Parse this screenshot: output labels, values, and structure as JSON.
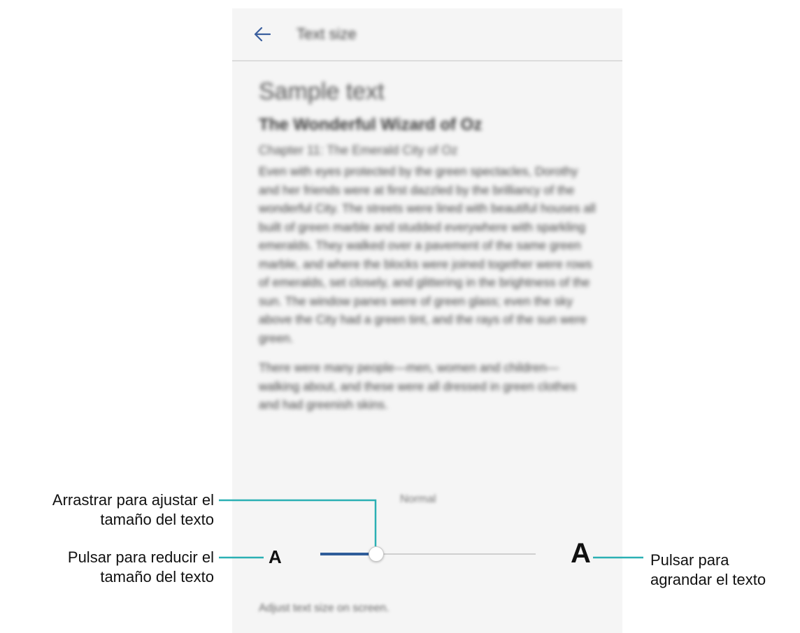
{
  "header": {
    "title": "Text size",
    "back_icon": "arrow-left-icon"
  },
  "preview": {
    "heading": "Sample text",
    "book_title": "The Wonderful Wizard of Oz",
    "chapter": "Chapter 11: The Emerald City of Oz",
    "paragraphs": [
      "Even with eyes protected by the green spectacles, Dorothy and her friends were at first dazzled by the brilliancy of the wonderful City. The streets were lined with beautiful houses all built of green marble and studded everywhere with sparkling emeralds. They walked over a pavement of the same green marble, and where the blocks were joined together were rows of emeralds, set closely, and glittering in the brightness of the sun. The window panes were of green glass; even the sky above the City had a green tint, and the rays of the sun were green.",
      "There were many people—men, women and children—walking about, and these were all dressed in green clothes and had greenish skins."
    ]
  },
  "slider": {
    "current_label": "Normal",
    "small_label": "A",
    "large_label": "A",
    "value_fraction": 0.26
  },
  "footer_hint": "Adjust text size on screen.",
  "callouts": {
    "drag_line1": "Arrastrar para ajustar el",
    "drag_line2": "tamaño del texto",
    "reduce_line1": "Pulsar para reducir el",
    "reduce_line2": "tamaño del texto",
    "enlarge_line1": "Pulsar para",
    "enlarge_line2": "agrandar el texto"
  },
  "colors": {
    "accent": "#2f5d9a",
    "callout_line": "#2bb0b4",
    "screen_bg": "#f5f5f5"
  }
}
